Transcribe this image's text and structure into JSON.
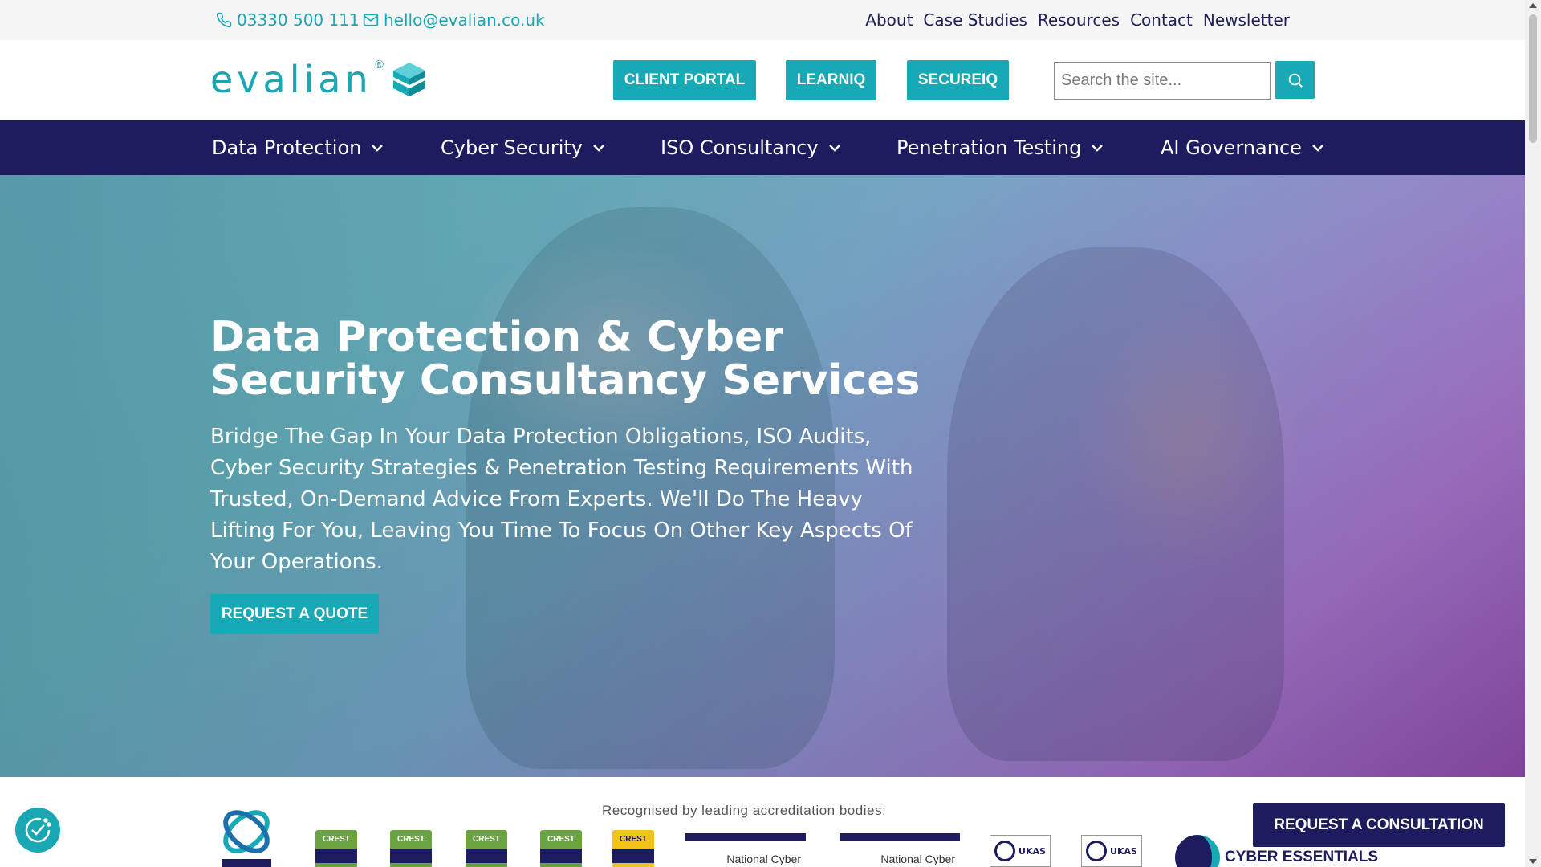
{
  "topbar": {
    "phone": "03330 500 111",
    "email": "hello@evalian.co.uk",
    "links": [
      "About",
      "Case Studies",
      "Resources",
      "Contact",
      "Newsletter"
    ]
  },
  "header": {
    "logo_text": "evalian",
    "logo_mark": "®",
    "buttons": [
      "CLIENT PORTAL",
      "LEARNIQ",
      "SECUREIQ"
    ],
    "search_placeholder": "Search the site..."
  },
  "nav": {
    "items": [
      "Data Protection",
      "Cyber Security",
      "ISO Consultancy",
      "Penetration Testing",
      "AI Governance"
    ]
  },
  "hero": {
    "title": "Data Protection & Cyber Security Consultancy Services",
    "subtitle": "Bridge The Gap In Your Data Protection Obligations, ISO Audits, Cyber Security Strategies & Penetration Testing Requirements With Trusted, On-Demand Advice From Experts. We'll Do The Heavy Lifting For You, Leaving You Time To Focus On Other Key Aspects Of Your Operations.",
    "cta": "REQUEST A QUOTE"
  },
  "accreditation": {
    "label": "Recognised by leading accreditation bodies:",
    "crest_badges": [
      "CREST",
      "CREST",
      "CREST",
      "CREST",
      "CREST"
    ],
    "ncsc_text": "National Cyber",
    "ukas_text": "UKAS",
    "cyber_essentials": "CYBER ESSENTIALS"
  },
  "floating": {
    "consult_cta": "REQUEST A CONSULTATION"
  },
  "colors": {
    "teal": "#17a9b6",
    "navy": "#1c1c5e"
  }
}
